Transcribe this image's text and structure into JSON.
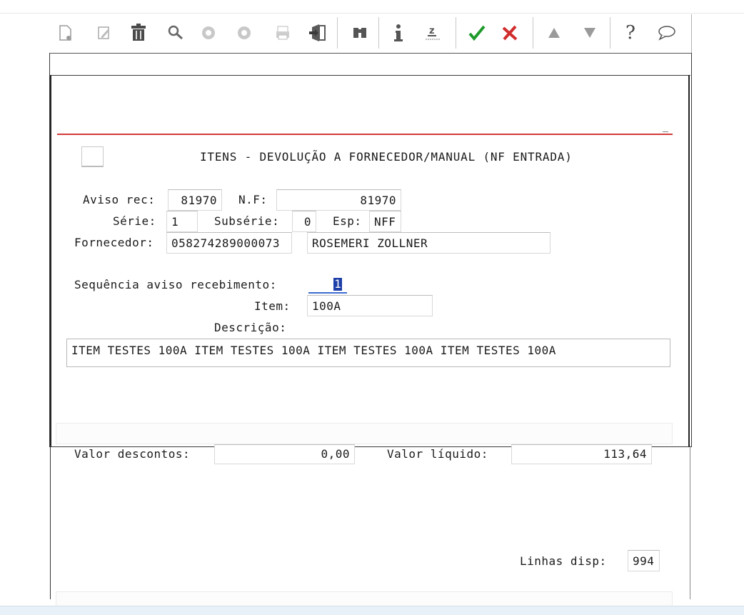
{
  "toolbar": {
    "buttons": [
      {
        "name": "new-icon",
        "glyph": "🗋"
      },
      {
        "name": "edit-icon",
        "glyph": "✎"
      },
      {
        "name": "trash-icon",
        "glyph": "🗑"
      },
      {
        "name": "search-icon",
        "glyph": "🔍"
      },
      {
        "name": "prev-icon",
        "glyph": "◀"
      },
      {
        "name": "next-icon",
        "glyph": "▶"
      },
      {
        "name": "print-icon",
        "glyph": "🖶"
      },
      {
        "name": "exit-icon",
        "glyph": "⇥"
      },
      {
        "name": "binoculars-icon",
        "glyph": "⚇"
      },
      {
        "name": "info-icon",
        "glyph": "i"
      },
      {
        "name": "zoom-icon",
        "glyph": "z"
      },
      {
        "name": "confirm-icon",
        "glyph": "✓"
      },
      {
        "name": "cancel-icon",
        "glyph": "✗"
      },
      {
        "name": "up-icon",
        "glyph": "▲"
      },
      {
        "name": "down-icon",
        "glyph": "▼"
      },
      {
        "name": "help-icon",
        "glyph": "?"
      },
      {
        "name": "chat-icon",
        "glyph": "💬"
      }
    ],
    "colors": {
      "check": "#1e9a2a",
      "cross": "#d12c2c",
      "gray": "#8a8a8a",
      "dark": "#444444"
    }
  },
  "form": {
    "title": "ITENS - DEVOLUÇÃO A FORNECEDOR/MANUAL (NF ENTRADA)",
    "aviso_label": "Aviso rec:",
    "aviso_value": "81970",
    "nf_label": "N.F:",
    "nf_value": "81970",
    "serie_label": "Série:",
    "serie_value": "1",
    "subserie_label": "Subsérie:",
    "subserie_value": "0",
    "esp_label": "Esp:",
    "esp_value": "NFF",
    "fornecedor_label": "Fornecedor:",
    "fornecedor_code": "058274289000073",
    "fornecedor_name": "ROSEMERI ZOLLNER",
    "seq_label": "Sequência aviso recebimento:",
    "seq_value": "1",
    "item_label": "Item:",
    "item_value": "100A",
    "descricao_label": "Descrição:",
    "descricao_value": "ITEM TESTES 100A ITEM TESTES 100A ITEM TESTES 100A ITEM TESTES 100A",
    "valor_descontos_label": "Valor descontos:",
    "valor_descontos_value": "0,00",
    "valor_liquido_label": "Valor líquido:",
    "valor_liquido_value": "113,64",
    "linhas_label": "Linhas disp:",
    "linhas_value": "994"
  },
  "accent_colors": {
    "divider": "#d43a3a",
    "focus": "#3b6bd2"
  }
}
